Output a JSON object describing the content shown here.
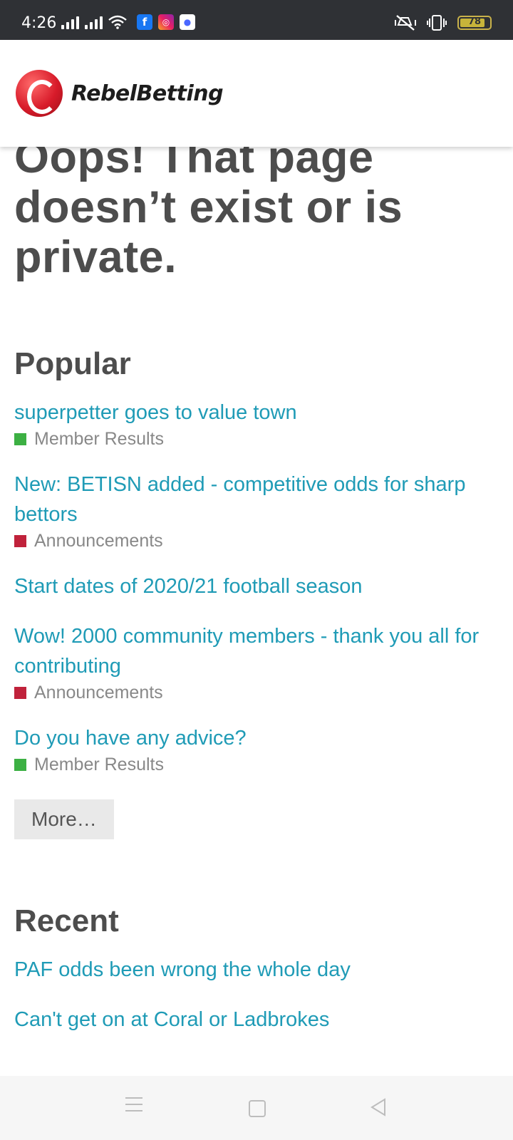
{
  "status_bar": {
    "time": "4:26",
    "battery_percent": "78",
    "icons": [
      "signal-icon",
      "signal-icon",
      "wifi-icon",
      "facebook-icon",
      "instagram-icon",
      "messenger-icon",
      "mute-icon",
      "vibrate-icon",
      "battery-icon"
    ],
    "battery_color": "#c7b43a"
  },
  "header": {
    "logo_text": "RebelBetting",
    "brand_color": "#d81b2a"
  },
  "main": {
    "title": "Oops! That page doesn’t exist or is private.",
    "popular": {
      "heading": "Popular",
      "topics": [
        {
          "title": "superpetter goes to value town",
          "category": "Member Results",
          "category_color": "#3cb043"
        },
        {
          "title": "New: BETISN added - competitive odds for sharp bettors",
          "category": "Announcements",
          "category_color": "#c0223b"
        },
        {
          "title": "Start dates of 2020/21 football season",
          "category": "",
          "category_color": ""
        },
        {
          "title": "Wow! 2000 community members - thank you all for contributing",
          "category": "Announcements",
          "category_color": "#c0223b"
        },
        {
          "title": "Do you have any advice?",
          "category": "Member Results",
          "category_color": "#3cb043"
        }
      ],
      "more_label": "More…"
    },
    "recent": {
      "heading": "Recent",
      "topics": [
        {
          "title": "PAF odds been wrong the whole day"
        },
        {
          "title": "Can't get on at Coral or Ladbrokes"
        }
      ]
    },
    "link_color": "#1f9bb6"
  },
  "nav_bar": {
    "icons": [
      "menu-icon",
      "home-icon",
      "back-icon"
    ]
  }
}
